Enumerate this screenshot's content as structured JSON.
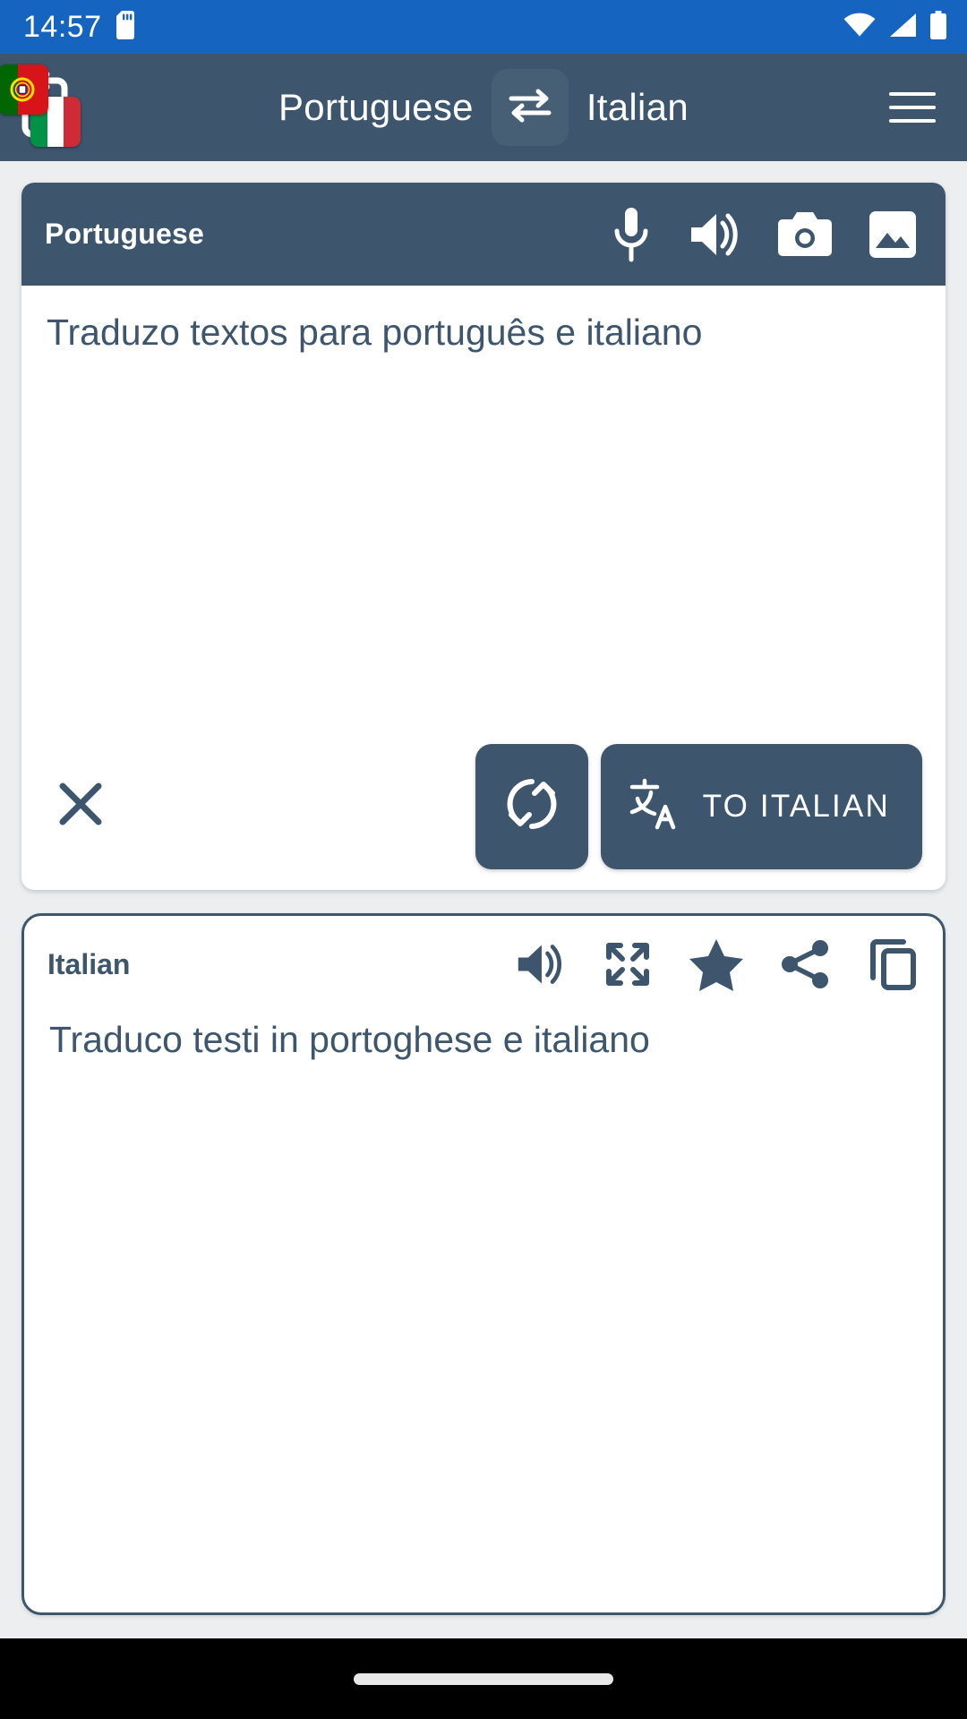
{
  "status_bar": {
    "time": "14:57",
    "icons": [
      "sd-card-icon",
      "wifi-icon",
      "cellular-signal-icon",
      "battery-icon"
    ],
    "background_color": "#1565c0"
  },
  "app_bar": {
    "app_icon": "translate-flags-app-icon",
    "source_language": "Portuguese",
    "target_language": "Italian",
    "swap_icon": "swap-horizontal-icon",
    "menu_icon": "hamburger-menu-icon",
    "background_color": "#3d566e"
  },
  "source_card": {
    "language_label": "Portuguese",
    "header_icons": [
      {
        "name": "microphone-icon",
        "label": "Voice input"
      },
      {
        "name": "speaker-icon",
        "label": "Listen"
      },
      {
        "name": "camera-icon",
        "label": "Camera"
      },
      {
        "name": "image-icon",
        "label": "Gallery"
      }
    ],
    "text": "Traduzo textos para português e italiano",
    "placeholder": "",
    "clear_icon": "close-icon",
    "sync_icon": "sync-swap-icon",
    "translate_icon": "translate-icon",
    "translate_label": "TO ITALIAN"
  },
  "result_card": {
    "language_label": "Italian",
    "header_icons": [
      {
        "name": "speaker-icon",
        "label": "Listen"
      },
      {
        "name": "fullscreen-icon",
        "label": "Fullscreen"
      },
      {
        "name": "star-icon",
        "label": "Favorite"
      },
      {
        "name": "share-icon",
        "label": "Share"
      },
      {
        "name": "copy-icon",
        "label": "Copy"
      }
    ],
    "text": "Traduco testi in portoghese e italiano"
  },
  "nav_bar": {
    "gesture_pill": "home-gesture-pill"
  },
  "theme": {
    "accent": "#3d566e",
    "status_bar": "#1565c0",
    "page_background": "#eceef0",
    "card_background": "#ffffff",
    "text_color": "#3d566e"
  }
}
